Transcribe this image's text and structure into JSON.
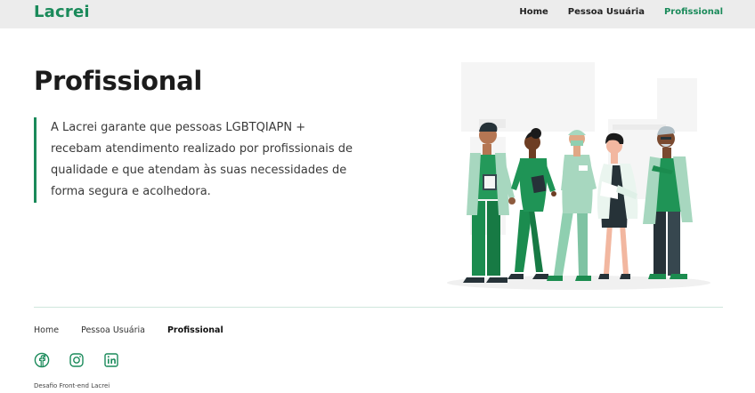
{
  "header": {
    "logo": "Lacrei",
    "nav": [
      {
        "label": "Home",
        "active": false
      },
      {
        "label": "Pessoa Usuária",
        "active": false
      },
      {
        "label": "Profissional",
        "active": true
      }
    ]
  },
  "main": {
    "title": "Profissional",
    "description": "A Lacrei garante que pessoas LGBTQIAPN + recebam atendimento realizado por profissionais de qualidade e que atendam às suas necessidades de forma segura e acolhedora."
  },
  "footer": {
    "nav": [
      {
        "label": "Home",
        "active": false
      },
      {
        "label": "Pessoa Usuária",
        "active": false
      },
      {
        "label": "Profissional",
        "active": true
      }
    ],
    "social": [
      "facebook-icon",
      "instagram-icon",
      "linkedin-icon"
    ],
    "copyright": "Desafio Front-end Lacrei"
  },
  "colors": {
    "brand": "#1a8a5a",
    "header_bg": "#ececec"
  }
}
